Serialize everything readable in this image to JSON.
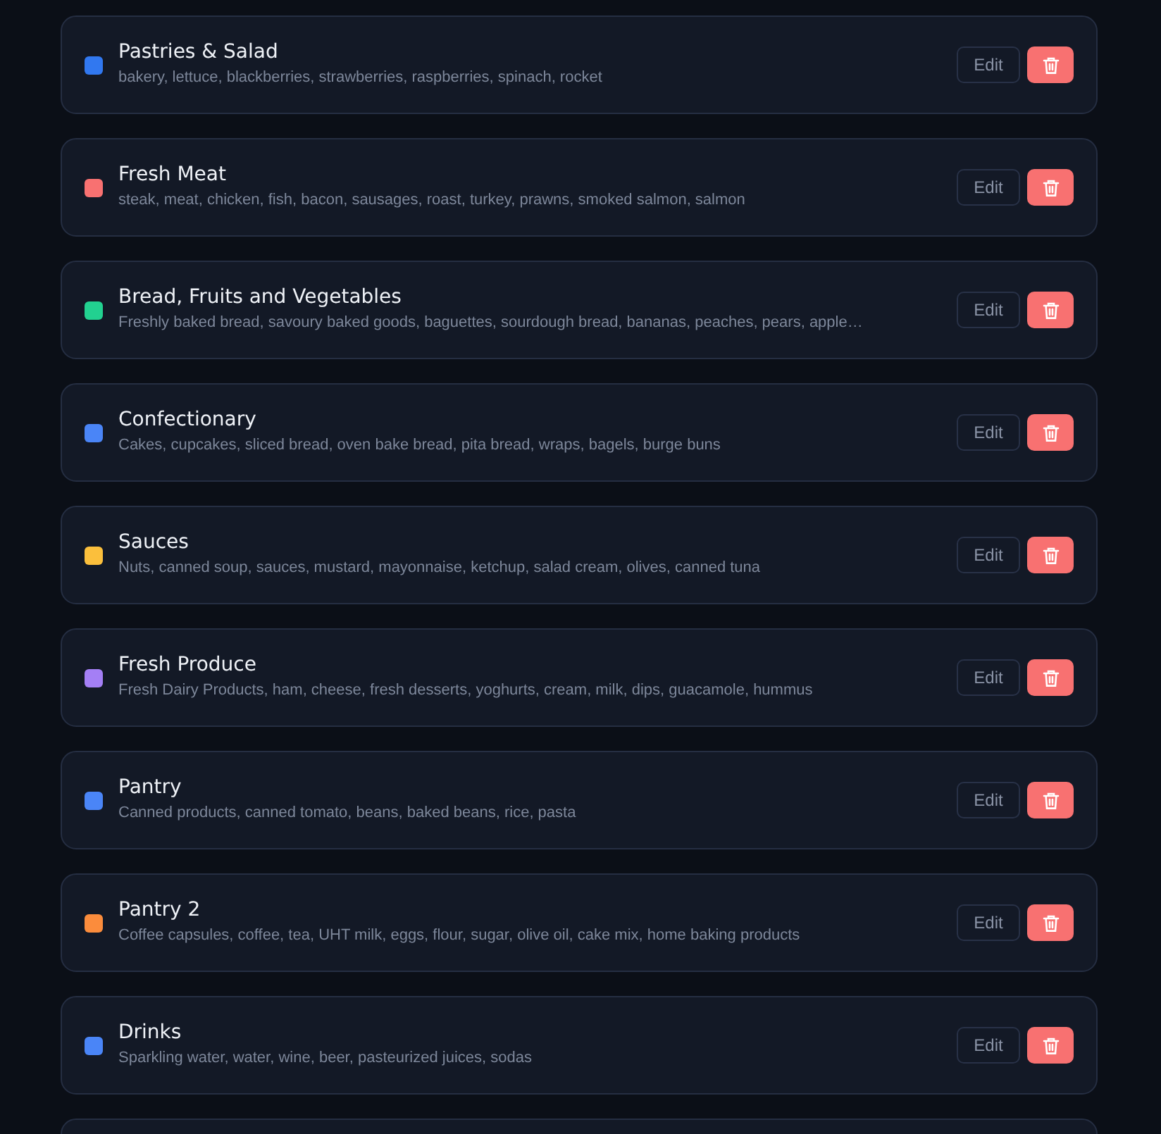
{
  "categories": [
    {
      "name": "Pastries & Salad",
      "items": "bakery, lettuce, blackberries, strawberries, raspberries, spinach, rocket",
      "color": "#3178f0",
      "edit": "Edit"
    },
    {
      "name": "Fresh Meat",
      "items": "steak, meat, chicken, fish, bacon, sausages, roast, turkey, prawns, smoked salmon, salmon",
      "color": "#f87171",
      "edit": "Edit"
    },
    {
      "name": "Bread, Fruits and Vegetables",
      "items": "Freshly baked bread, savoury baked goods, baguettes, sourdough bread, bananas, peaches, pears, apple…",
      "color": "#22d190",
      "edit": "Edit"
    },
    {
      "name": "Confectionary",
      "items": "Cakes, cupcakes, sliced bread, oven bake bread, pita bread, wraps, bagels, burge buns",
      "color": "#4a85f7",
      "edit": "Edit"
    },
    {
      "name": "Sauces",
      "items": "Nuts, canned soup, sauces, mustard, mayonnaise, ketchup, salad cream, olives, canned tuna",
      "color": "#fbbf3c",
      "edit": "Edit"
    },
    {
      "name": "Fresh Produce",
      "items": "Fresh Dairy Products, ham, cheese, fresh desserts, yoghurts, cream, milk, dips, guacamole, hummus",
      "color": "#a47ff5",
      "edit": "Edit"
    },
    {
      "name": "Pantry",
      "items": "Canned products, canned tomato, beans, baked beans, rice, pasta",
      "color": "#4a85f7",
      "edit": "Edit"
    },
    {
      "name": "Pantry 2",
      "items": "Coffee capsules, coffee, tea, UHT milk, eggs, flour, sugar, olive oil, cake mix, home baking products",
      "color": "#fb8c3c",
      "edit": "Edit"
    },
    {
      "name": "Drinks",
      "items": "Sparkling water, water, wine, beer, pasteurized juices, sodas",
      "color": "#4a85f7",
      "edit": "Edit"
    }
  ]
}
